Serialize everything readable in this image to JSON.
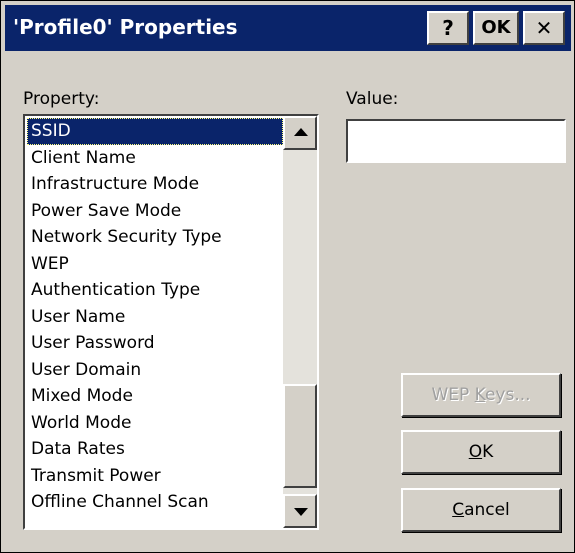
{
  "window": {
    "title": "'Profile0' Properties",
    "help_label": "?",
    "ok_label": "OK",
    "close_label": "✕"
  },
  "property_label": "Property:",
  "value_label": "Value:",
  "value_field": {
    "value": "",
    "placeholder": ""
  },
  "properties": [
    "SSID",
    "Client Name",
    "Infrastructure Mode",
    "Power Save Mode",
    "Network Security Type",
    "WEP",
    "Authentication Type",
    "User Name",
    "User Password",
    "User Domain",
    "Mixed Mode",
    "World Mode",
    "Data Rates",
    "Transmit Power",
    "Offline Channel Scan"
  ],
  "selected_index": 0,
  "buttons": {
    "wep_keys": {
      "pre": "WEP ",
      "accel": "K",
      "post": "eys...",
      "enabled": false
    },
    "ok": {
      "pre": "",
      "accel": "O",
      "post": "K",
      "enabled": true
    },
    "cancel": {
      "pre": "",
      "accel": "C",
      "post": "ancel",
      "enabled": true
    }
  },
  "colors": {
    "titlebar": "#0a246a",
    "face": "#d4d0c8",
    "selection": "#0a246a"
  },
  "icons": {
    "scroll_up": "arrow-up-icon",
    "scroll_down": "arrow-down-icon",
    "close": "close-icon"
  }
}
